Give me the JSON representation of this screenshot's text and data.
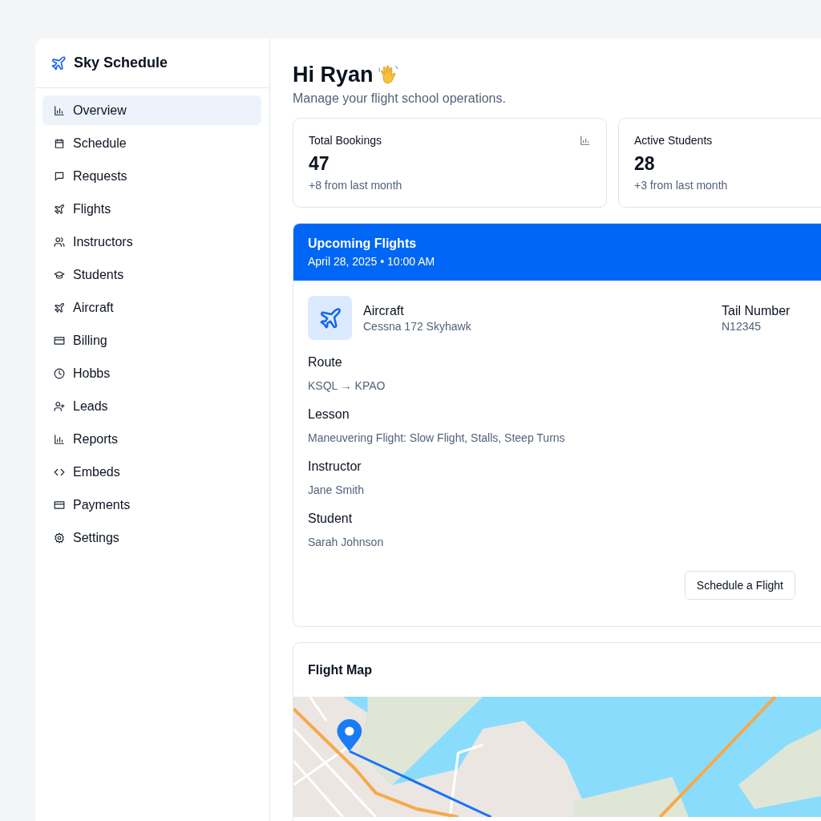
{
  "sidebar": {
    "brand": "Sky Schedule",
    "items": [
      {
        "label": "Overview",
        "selected": true
      },
      {
        "label": "Schedule",
        "selected": false
      },
      {
        "label": "Requests",
        "selected": false
      },
      {
        "label": "Flights",
        "selected": false
      },
      {
        "label": "Instructors",
        "selected": false
      },
      {
        "label": "Students",
        "selected": false
      },
      {
        "label": "Aircraft",
        "selected": false
      },
      {
        "label": "Billing",
        "selected": false
      },
      {
        "label": "Hobbs",
        "selected": false
      },
      {
        "label": "Leads",
        "selected": false
      },
      {
        "label": "Reports",
        "selected": false
      },
      {
        "label": "Embeds",
        "selected": false
      },
      {
        "label": "Payments",
        "selected": false
      },
      {
        "label": "Settings",
        "selected": false
      }
    ]
  },
  "header": {
    "greeting": "Hi Ryan",
    "subtitle": "Manage your flight school operations."
  },
  "stats": [
    {
      "kind": "with-icon",
      "label": "Total Bookings",
      "value": "47",
      "note": "+8 from last month"
    },
    {
      "kind": "plain",
      "label": "Active Students",
      "value": "28",
      "note": "+3 from last month"
    }
  ],
  "upcoming": {
    "title": "Upcoming Flights",
    "datetime": "April 28, 2025 • 10:00 AM",
    "aircraft": {
      "label": "Aircraft",
      "value": "Cessna 172 Skyhawk"
    },
    "tail": {
      "label": "Tail Number",
      "value": "N12345"
    },
    "details": [
      {
        "label": "Route",
        "value": "KSQL → KPAO"
      },
      {
        "label": "Lesson",
        "value": "Maneuvering Flight: Slow Flight, Stalls, Steep Turns"
      },
      {
        "label": "Instructor",
        "value": "Jane Smith"
      },
      {
        "label": "Student",
        "value": "Sarah Johnson"
      }
    ],
    "button": "Schedule a Flight"
  },
  "map": {
    "title": "Flight Map"
  }
}
